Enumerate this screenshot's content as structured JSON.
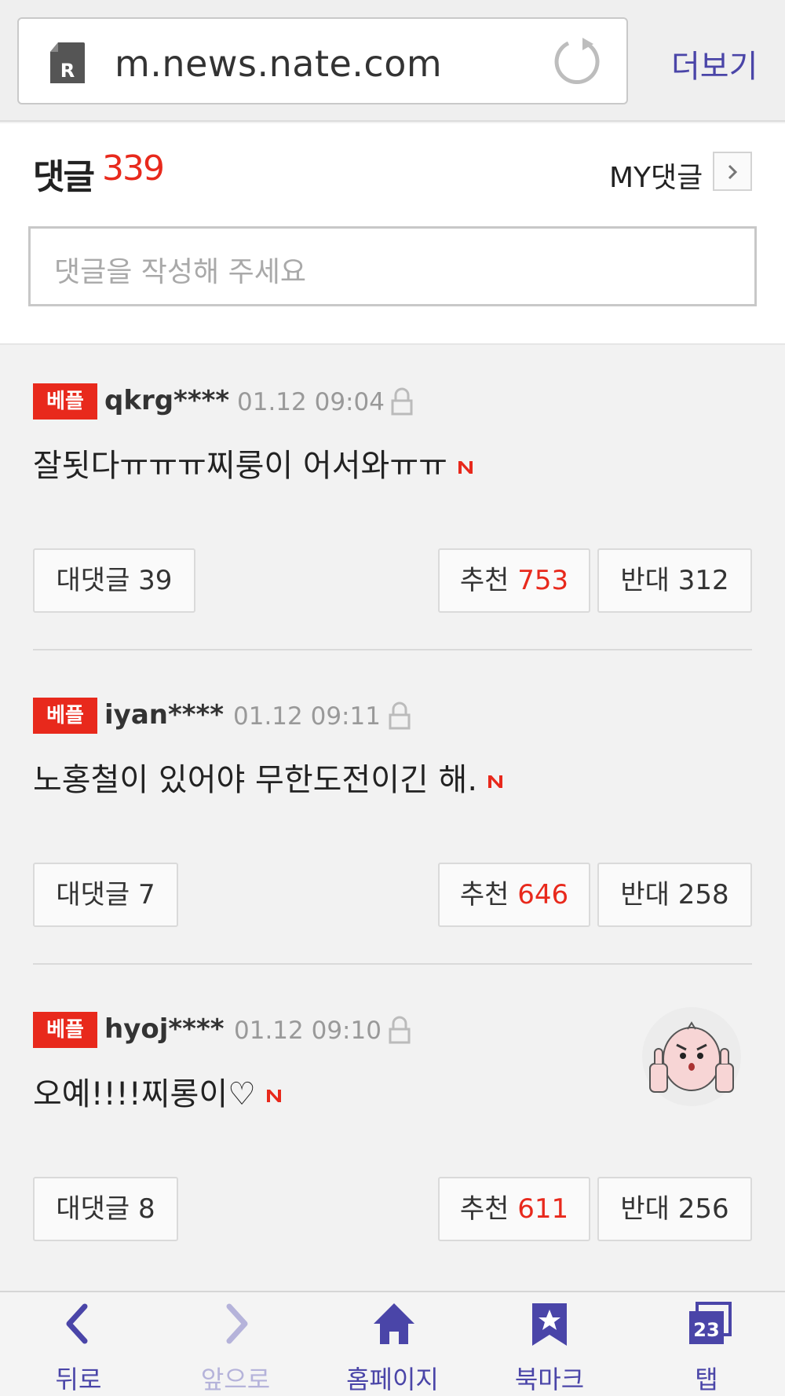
{
  "browser": {
    "url": "m.news.nate.com",
    "more_label": "더보기"
  },
  "comments_header": {
    "title": "댓글",
    "count": "339",
    "my_comments_label": "MY댓글",
    "input_placeholder": "댓글을 작성해 주세요"
  },
  "comments": [
    {
      "badge": "베플",
      "author": "qkrg****",
      "date": "01.12 09:04",
      "text": "잘됫다ㅠㅠㅠ찌룽이 어서와ㅠㅠ",
      "reply_label": "대댓글 39",
      "recommend_label": "추천",
      "recommend_count": "753",
      "oppose_label": "반대 312"
    },
    {
      "badge": "베플",
      "author": "iyan****",
      "date": "01.12 09:11",
      "text": "노홍철이 있어야 무한도전이긴 해.",
      "reply_label": "대댓글 7",
      "recommend_label": "추천",
      "recommend_count": "646",
      "oppose_label": "반대 258"
    },
    {
      "badge": "베플",
      "author": "hyoj****",
      "date": "01.12 09:10",
      "text": "오예!!!!찌롱이♡",
      "reply_label": "대댓글 8",
      "recommend_label": "추천",
      "recommend_count": "611",
      "oppose_label": "반대 256"
    }
  ],
  "bottom_nav": [
    {
      "label": "뒤로",
      "icon": "back-arrow-icon",
      "enabled": true
    },
    {
      "label": "앞으로",
      "icon": "forward-arrow-icon",
      "enabled": false
    },
    {
      "label": "홈페이지",
      "icon": "home-icon",
      "enabled": true
    },
    {
      "label": "북마크",
      "icon": "bookmark-star-icon",
      "enabled": true
    },
    {
      "label": "탭",
      "icon": "tabs-icon",
      "enabled": true,
      "tab_count": "23"
    }
  ],
  "colors": {
    "accent_red": "#e8291c",
    "nav_purple": "#4a45a8",
    "nav_disabled": "#b5b3da"
  }
}
